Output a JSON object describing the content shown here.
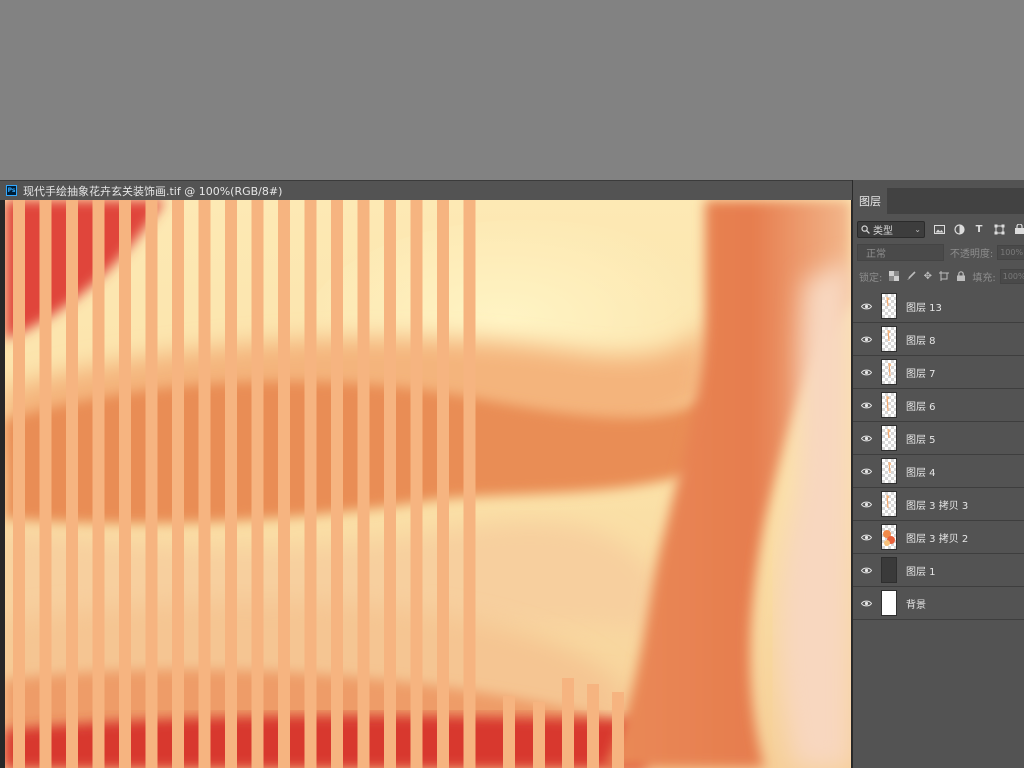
{
  "document": {
    "title": "现代手绘抽象花卉玄关装饰画.tif @ 100%(RGB/8#)",
    "app_badge": "Ps"
  },
  "panel": {
    "tab_label": "图层",
    "filter_label": "类型",
    "blend_mode": "正常",
    "opacity_label": "不透明度:",
    "opacity_value": "100%",
    "lock_label": "锁定:",
    "fill_label": "填充:",
    "fill_value": "100%",
    "filter_icons": [
      "image-icon",
      "adjustment-icon",
      "type-icon",
      "shape-icon",
      "smart-object-icon"
    ],
    "lock_icons": [
      "lock-transparent-icon",
      "lock-brush-icon",
      "lock-move-icon",
      "lock-artboard-icon",
      "lock-all-icon"
    ]
  },
  "layers": [
    {
      "name": "图层 13",
      "thumb": "transparent",
      "visible": true
    },
    {
      "name": "图层 8",
      "thumb": "transparent",
      "visible": true
    },
    {
      "name": "图层 7",
      "thumb": "transparent",
      "visible": true
    },
    {
      "name": "图层 6",
      "thumb": "transparent",
      "visible": true
    },
    {
      "name": "图层 5",
      "thumb": "transparent",
      "visible": true
    },
    {
      "name": "图层 4",
      "thumb": "transparent",
      "visible": true
    },
    {
      "name": "图层 3 拷贝 3",
      "thumb": "transparent",
      "visible": true
    },
    {
      "name": "图层 3 拷贝 2",
      "thumb": "painted",
      "visible": true
    },
    {
      "name": "图层 1",
      "thumb": "dark",
      "visible": true
    },
    {
      "name": "背景",
      "thumb": "white",
      "visible": true
    }
  ],
  "colors": {
    "workspace": "#828282",
    "panel": "#535353",
    "stripe": "#f6b480",
    "ps_blue": "#31a8ff"
  }
}
